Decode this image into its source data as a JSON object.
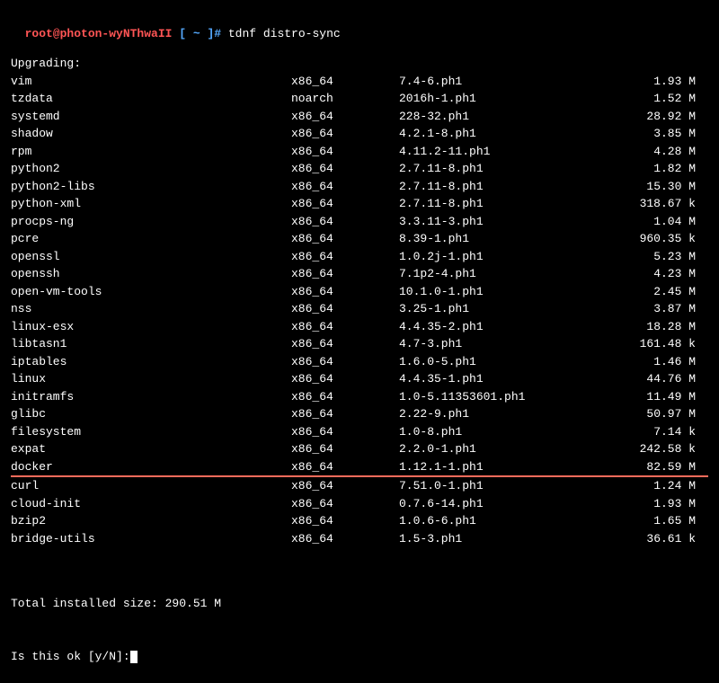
{
  "prompt": {
    "user_host": "root@photon-wyNThwaII",
    "path_segment": " [ ~ ]#",
    "command": " tdnf distro-sync"
  },
  "section_header": "Upgrading:",
  "packages": [
    {
      "name": "vim",
      "arch": "x86_64",
      "version": "7.4-6.ph1",
      "size": "1.93 M",
      "highlighted": false
    },
    {
      "name": "tzdata",
      "arch": "noarch",
      "version": "2016h-1.ph1",
      "size": "1.52 M",
      "highlighted": false
    },
    {
      "name": "systemd",
      "arch": "x86_64",
      "version": "228-32.ph1",
      "size": "28.92 M",
      "highlighted": false
    },
    {
      "name": "shadow",
      "arch": "x86_64",
      "version": "4.2.1-8.ph1",
      "size": "3.85 M",
      "highlighted": false
    },
    {
      "name": "rpm",
      "arch": "x86_64",
      "version": "4.11.2-11.ph1",
      "size": "4.28 M",
      "highlighted": false
    },
    {
      "name": "python2",
      "arch": "x86_64",
      "version": "2.7.11-8.ph1",
      "size": "1.82 M",
      "highlighted": false
    },
    {
      "name": "python2-libs",
      "arch": "x86_64",
      "version": "2.7.11-8.ph1",
      "size": "15.30 M",
      "highlighted": false
    },
    {
      "name": "python-xml",
      "arch": "x86_64",
      "version": "2.7.11-8.ph1",
      "size": "318.67 k",
      "highlighted": false
    },
    {
      "name": "procps-ng",
      "arch": "x86_64",
      "version": "3.3.11-3.ph1",
      "size": "1.04 M",
      "highlighted": false
    },
    {
      "name": "pcre",
      "arch": "x86_64",
      "version": "8.39-1.ph1",
      "size": "960.35 k",
      "highlighted": false
    },
    {
      "name": "openssl",
      "arch": "x86_64",
      "version": "1.0.2j-1.ph1",
      "size": "5.23 M",
      "highlighted": false
    },
    {
      "name": "openssh",
      "arch": "x86_64",
      "version": "7.1p2-4.ph1",
      "size": "4.23 M",
      "highlighted": false
    },
    {
      "name": "open-vm-tools",
      "arch": "x86_64",
      "version": "10.1.0-1.ph1",
      "size": "2.45 M",
      "highlighted": false
    },
    {
      "name": "nss",
      "arch": "x86_64",
      "version": "3.25-1.ph1",
      "size": "3.87 M",
      "highlighted": false
    },
    {
      "name": "linux-esx",
      "arch": "x86_64",
      "version": "4.4.35-2.ph1",
      "size": "18.28 M",
      "highlighted": false
    },
    {
      "name": "libtasn1",
      "arch": "x86_64",
      "version": "4.7-3.ph1",
      "size": "161.48 k",
      "highlighted": false
    },
    {
      "name": "iptables",
      "arch": "x86_64",
      "version": "1.6.0-5.ph1",
      "size": "1.46 M",
      "highlighted": false
    },
    {
      "name": "linux",
      "arch": "x86_64",
      "version": "4.4.35-1.ph1",
      "size": "44.76 M",
      "highlighted": false
    },
    {
      "name": "initramfs",
      "arch": "x86_64",
      "version": "1.0-5.11353601.ph1",
      "size": "11.49 M",
      "highlighted": false
    },
    {
      "name": "glibc",
      "arch": "x86_64",
      "version": "2.22-9.ph1",
      "size": "50.97 M",
      "highlighted": false
    },
    {
      "name": "filesystem",
      "arch": "x86_64",
      "version": "1.0-8.ph1",
      "size": "7.14 k",
      "highlighted": false
    },
    {
      "name": "expat",
      "arch": "x86_64",
      "version": "2.2.0-1.ph1",
      "size": "242.58 k",
      "highlighted": false
    },
    {
      "name": "docker",
      "arch": "x86_64",
      "version": "1.12.1-1.ph1",
      "size": "82.59 M",
      "highlighted": true
    },
    {
      "name": "curl",
      "arch": "x86_64",
      "version": "7.51.0-1.ph1",
      "size": "1.24 M",
      "highlighted": false
    },
    {
      "name": "cloud-init",
      "arch": "x86_64",
      "version": "0.7.6-14.ph1",
      "size": "1.93 M",
      "highlighted": false
    },
    {
      "name": "bzip2",
      "arch": "x86_64",
      "version": "1.0.6-6.ph1",
      "size": "1.65 M",
      "highlighted": false
    },
    {
      "name": "bridge-utils",
      "arch": "x86_64",
      "version": "1.5-3.ph1",
      "size": "36.61 k",
      "highlighted": false
    }
  ],
  "footer": {
    "total_line": "Total installed size: 290.51 M",
    "confirm_line": "Is this ok [y/N]:"
  }
}
